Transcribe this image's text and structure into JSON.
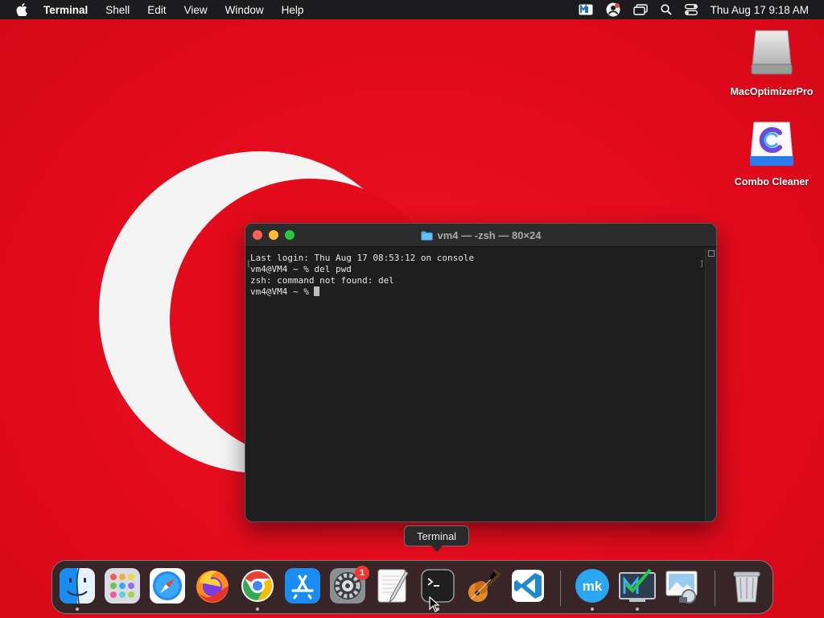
{
  "menubar": {
    "app_name": "Terminal",
    "menus": [
      "Shell",
      "Edit",
      "View",
      "Window",
      "Help"
    ],
    "clock": "Thu Aug 17  9:18 AM",
    "status_icons": [
      "malwarebytes-icon",
      "user-badge-icon",
      "screen-mirroring-icon",
      "spotlight-search-icon",
      "control-center-icon"
    ]
  },
  "desktop": {
    "icons": [
      {
        "name": "macoptimizerpro",
        "label": "MacOptimizerPro"
      },
      {
        "name": "combo-cleaner",
        "label": "Combo Cleaner"
      }
    ]
  },
  "terminal": {
    "title": "vm4 — -zsh — 80×24",
    "lines": [
      "Last login: Thu Aug 17 08:53:12 on console",
      "vm4@VM4 ~ % del pwd",
      "zsh: command not found: del",
      "vm4@VM4 ~ % "
    ]
  },
  "tooltip": {
    "text": "Terminal"
  },
  "dock": {
    "apps": [
      "Finder",
      "Launchpad",
      "Safari",
      "Firefox",
      "Chrome",
      "App Store",
      "System Settings",
      "TextEdit",
      "Terminal",
      "GarageBand",
      "Visual Studio Code",
      "MacKeeper",
      "Malwarebytes",
      "Preview",
      "Trash"
    ],
    "settings_badge": "1"
  },
  "colors": {
    "wallpaper_red": "#e30a1b",
    "menubar": "#1c1c1e",
    "terminal_bg": "#1e1e1e",
    "close": "#fe5f57",
    "minimize": "#febc2e",
    "maximize": "#28c840"
  }
}
